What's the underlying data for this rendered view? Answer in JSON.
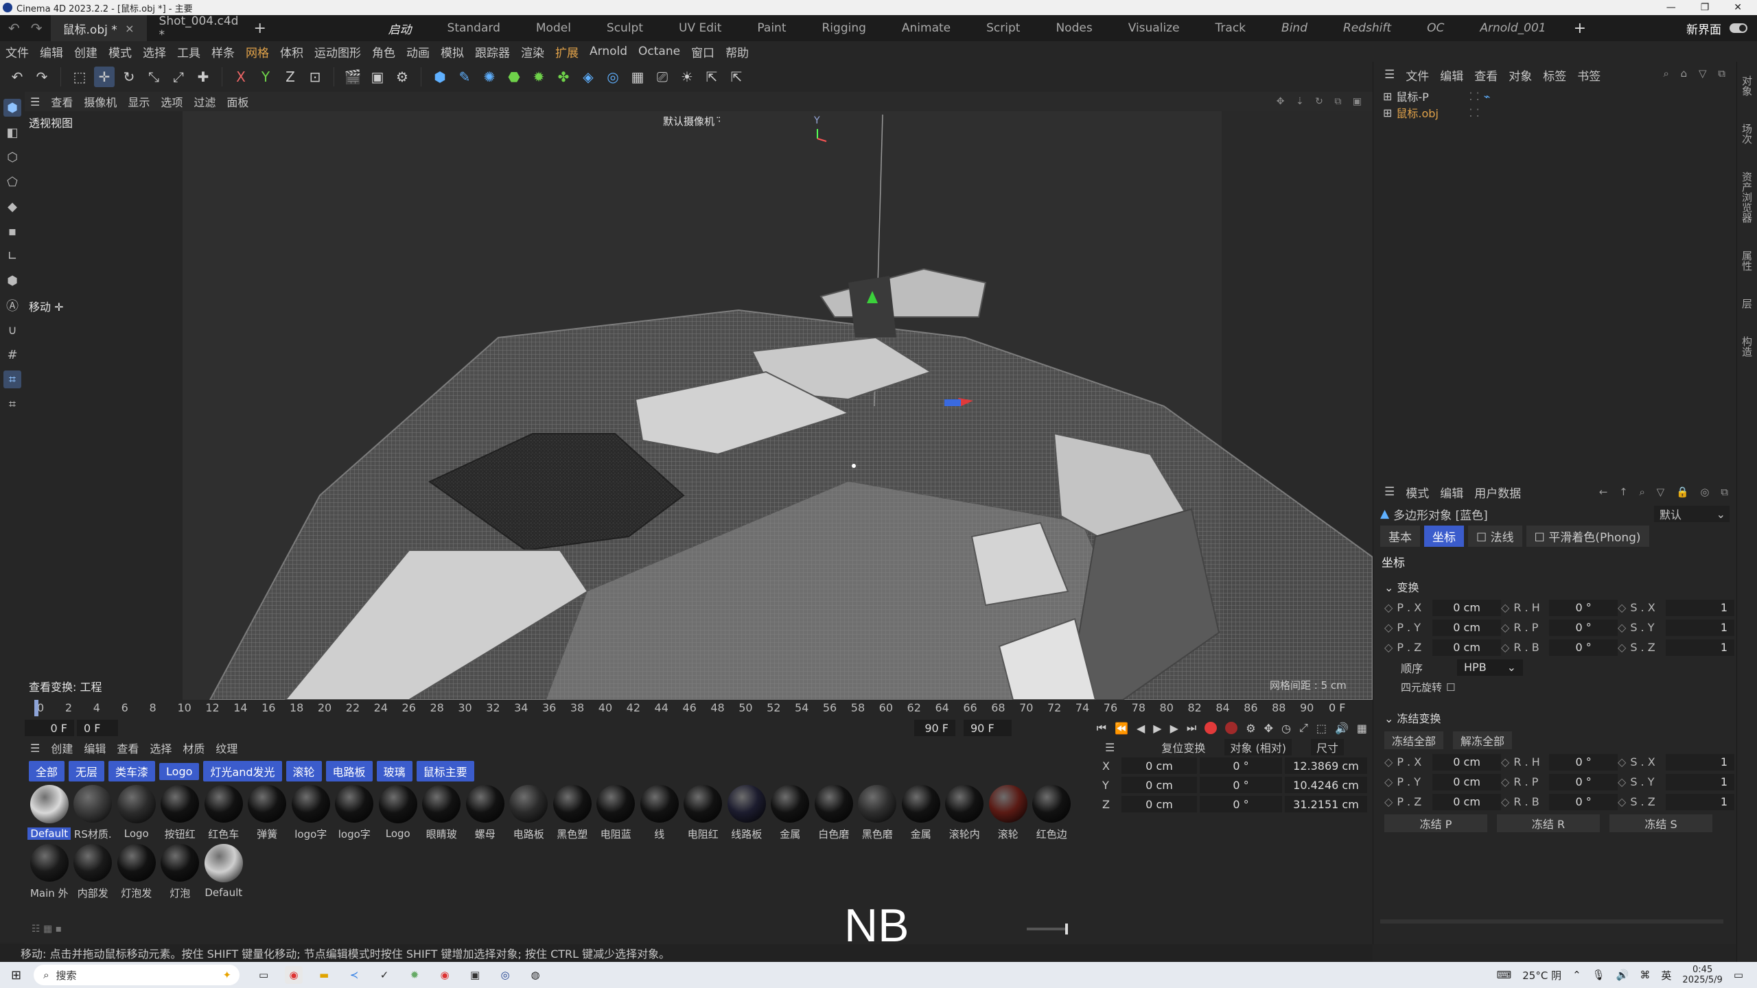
{
  "window": {
    "title": "Cinema 4D 2023.2.2 - [鼠标.obj *] - 主要"
  },
  "doc_tabs": [
    {
      "label": "鼠标.obj *",
      "close": "×"
    },
    {
      "label": "Shot_004.c4d *"
    }
  ],
  "add_tab": "+",
  "layouts": [
    "启动",
    "Standard",
    "Model",
    "Sculpt",
    "UV Edit",
    "Paint",
    "Rigging",
    "Animate",
    "Script",
    "Nodes",
    "Visualize",
    "Track",
    "Bind",
    "Redshift",
    "OC",
    "Arnold_001"
  ],
  "layout_add": "+",
  "new_ui": "新界面",
  "menu": [
    "文件",
    "编辑",
    "创建",
    "模式",
    "选择",
    "工具",
    "样条",
    "网格",
    "体积",
    "运动图形",
    "角色",
    "动画",
    "模拟",
    "跟踪器",
    "渲染",
    "扩展",
    "Arnold",
    "Octane",
    "窗口",
    "帮助"
  ],
  "viewport": {
    "menu": [
      "查看",
      "摄像机",
      "显示",
      "选项",
      "过滤",
      "面板"
    ],
    "label": "透视视图",
    "camera": "默认摄像机 ·̈",
    "move_hint": "移动 ✛",
    "view_transform": "查看变换: 工程",
    "grid_spacing": "网格间距 : 5 cm",
    "axis_y": "Y"
  },
  "timeline": {
    "ticks": [
      "0",
      "2",
      "4",
      "6",
      "8",
      "10",
      "12",
      "14",
      "16",
      "18",
      "20",
      "22",
      "24",
      "26",
      "28",
      "30",
      "32",
      "34",
      "36",
      "38",
      "40",
      "42",
      "44",
      "46",
      "48",
      "50",
      "52",
      "54",
      "56",
      "58",
      "60",
      "62",
      "64",
      "66",
      "68",
      "70",
      "72",
      "74",
      "76",
      "78",
      "80",
      "82",
      "84",
      "86",
      "88",
      "90"
    ],
    "current_frame_label": "0 F",
    "start": "0 F",
    "min": "0 F",
    "end_a": "90 F",
    "end_b": "90 F"
  },
  "materials": {
    "menu": [
      "创建",
      "编辑",
      "查看",
      "选择",
      "材质",
      "纹理"
    ],
    "chips": [
      "全部",
      "无层",
      "类车漆",
      "Logo",
      "灯光and发光",
      "滚轮",
      "电路板",
      "玻璃",
      "鼠标主要"
    ],
    "items": [
      {
        "label": "Default",
        "color": "#d9d9d9",
        "selected": true
      },
      {
        "label": "RS材质.",
        "color": "#3a3a3a"
      },
      {
        "label": "Logo",
        "color": "#2b2b2b"
      },
      {
        "label": "按钮红",
        "color": "#121212"
      },
      {
        "label": "红色车",
        "color": "#121212"
      },
      {
        "label": "弹簧",
        "color": "#121212"
      },
      {
        "label": "logo字",
        "color": "#121212"
      },
      {
        "label": "logo字",
        "color": "#121212"
      },
      {
        "label": "Logo",
        "color": "#121212"
      },
      {
        "label": "眼睛玻",
        "color": "#121212"
      },
      {
        "label": "螺母",
        "color": "#121212"
      },
      {
        "label": "电路板",
        "color": "#2a2a2a"
      },
      {
        "label": "黑色塑",
        "color": "#121212"
      },
      {
        "label": "电阻蓝",
        "color": "#121212"
      },
      {
        "label": "线",
        "color": "#121212"
      },
      {
        "label": "电阻红",
        "color": "#121212"
      },
      {
        "label": "线路板",
        "color": "#1c1c2e"
      },
      {
        "label": "金属",
        "color": "#121212"
      },
      {
        "label": "白色磨",
        "color": "#121212"
      },
      {
        "label": "黑色磨",
        "color": "#2e2e2e"
      },
      {
        "label": "金属",
        "color": "#121212"
      },
      {
        "label": "滚轮内",
        "color": "#121212"
      },
      {
        "label": "滚轮",
        "color": "#5a1a14"
      },
      {
        "label": "红色边",
        "color": "#121212"
      },
      {
        "label": "Main 外",
        "color": "#1a1a1a"
      },
      {
        "label": "内部发",
        "color": "#1a1a1a"
      },
      {
        "label": "灯泡发",
        "color": "#121212"
      },
      {
        "label": "灯泡",
        "color": "#121212"
      },
      {
        "label": "Default",
        "color": "#cfcfcf"
      }
    ]
  },
  "coords": {
    "header": [
      "复位变换",
      "对象 (相对)",
      "尺寸"
    ],
    "rows": [
      {
        "axis": "X",
        "pos": "0 cm",
        "rot": "0 °",
        "size": "12.3869 cm"
      },
      {
        "axis": "Y",
        "pos": "0 cm",
        "rot": "0 °",
        "size": "10.4246 cm"
      },
      {
        "axis": "Z",
        "pos": "0 cm",
        "rot": "0 °",
        "size": "31.2151 cm"
      }
    ]
  },
  "object_manager": {
    "menu": [
      "文件",
      "编辑",
      "查看",
      "对象",
      "标签",
      "书签"
    ],
    "objects": [
      {
        "name": "鼠标-P",
        "color": "#cfcfcf"
      },
      {
        "name": "鼠标.obj",
        "color": "#e0a24a"
      }
    ]
  },
  "attributes": {
    "menu": [
      "模式",
      "编辑",
      "用户数据"
    ],
    "object": "多边形对象 [蓝色]",
    "preset": "默认",
    "tabs": [
      "基本",
      "坐标",
      "法线",
      "平滑着色(Phong)"
    ],
    "section": "坐标",
    "transform_label": "变换",
    "transform": [
      [
        "P . X",
        "0 cm",
        "R . H",
        "0 °",
        "S . X",
        "1"
      ],
      [
        "P . Y",
        "0 cm",
        "R . P",
        "0 °",
        "S . Y",
        "1"
      ],
      [
        "P . Z",
        "0 cm",
        "R . B",
        "0 °",
        "S . Z",
        "1"
      ]
    ],
    "order_label": "顺序",
    "order_value": "HPB",
    "quaternion": "四元旋转",
    "freeze_label": "冻结变换",
    "freeze_all": "冻结全部",
    "unfreeze_all": "解冻全部",
    "freeze": [
      [
        "P . X",
        "0 cm",
        "R . H",
        "0 °",
        "S . X",
        "1"
      ],
      [
        "P . Y",
        "0 cm",
        "R . P",
        "0 °",
        "S . Y",
        "1"
      ],
      [
        "P . Z",
        "0 cm",
        "R . B",
        "0 °",
        "S . Z",
        "1"
      ]
    ],
    "freeze_buttons": [
      "冻结 P",
      "冻结 R",
      "冻结 S"
    ]
  },
  "right_strip": [
    "对象",
    "场次",
    "资产浏览器",
    "属性",
    "层",
    "构造"
  ],
  "subtitle": "NB",
  "status": "移动: 点击并拖动鼠标移动元素。按住 SHIFT 键量化移动; 节点编辑模式时按住 SHIFT 键增加选择对象; 按住 CTRL 键减少选择对象。",
  "taskbar": {
    "search_placeholder": "搜索",
    "weather": "25°C 阴",
    "lang": "英",
    "time": "0:45",
    "date": "2025/5/9"
  }
}
